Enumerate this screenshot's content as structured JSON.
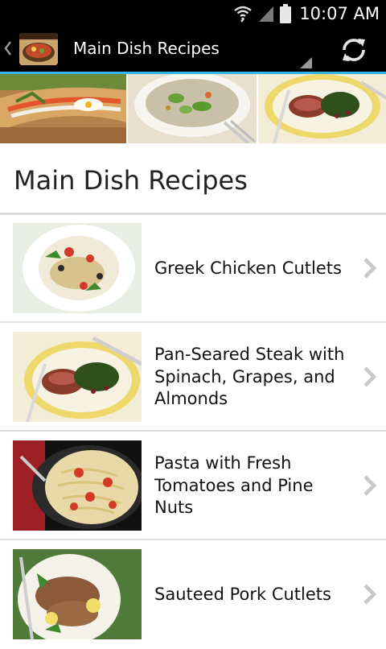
{
  "status_bar": {
    "time": "10:07 AM"
  },
  "action_bar": {
    "title": "Main Dish Recipes"
  },
  "page": {
    "title": "Main Dish Recipes"
  },
  "recipes": [
    {
      "title": "Greek Chicken Cutlets"
    },
    {
      "title": "Pan-Seared Steak with Spinach, Grapes, and Almonds"
    },
    {
      "title": "Pasta with Fresh Tomatoes and Pine Nuts"
    },
    {
      "title": "Sauteed Pork Cutlets"
    }
  ],
  "colors": {
    "accent": "#33b5e5",
    "bar": "#000000",
    "chevron": "#c8c8c8"
  },
  "icons": [
    "wifi-icon",
    "signal-icon",
    "battery-icon",
    "back-chevron-icon",
    "refresh-icon",
    "chevron-right-icon"
  ]
}
